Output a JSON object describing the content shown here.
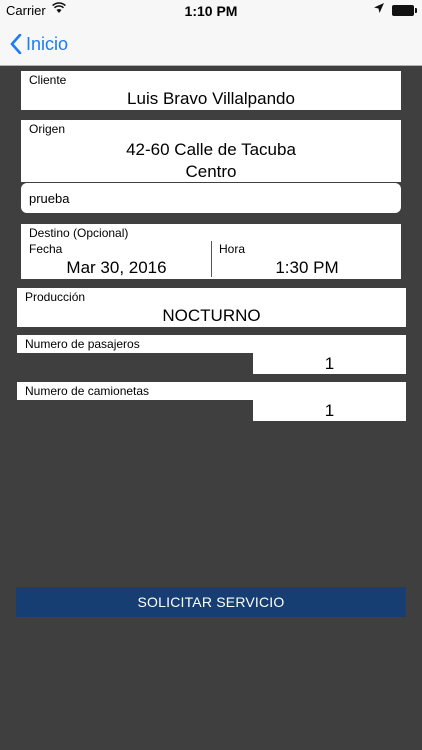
{
  "status_bar": {
    "carrier": "Carrier",
    "time": "1:10 PM"
  },
  "nav": {
    "back_label": "Inicio"
  },
  "form": {
    "cliente": {
      "label": "Cliente",
      "value": "Luis Bravo Villalpando"
    },
    "origen": {
      "label": "Origen",
      "line1": "42-60 Calle de Tacuba",
      "line2": "Centro"
    },
    "referencia": {
      "value": "prueba"
    },
    "destino": {
      "label": "Destino (Opcional)",
      "fecha_label": "Fecha",
      "fecha_value": "Mar 30, 2016",
      "hora_label": "Hora",
      "hora_value": "1:30 PM"
    },
    "produccion": {
      "label": "Producción",
      "value": "NOCTURNO"
    },
    "pasajeros": {
      "label": "Numero de pasajeros",
      "value": "1"
    },
    "camionetas": {
      "label": "Numero de camionetas",
      "value": "1"
    }
  },
  "submit_label": "SOLICITAR SERVICIO",
  "colors": {
    "background": "#3f3f3f",
    "accent": "#1a7cf7",
    "button": "#173e73"
  }
}
